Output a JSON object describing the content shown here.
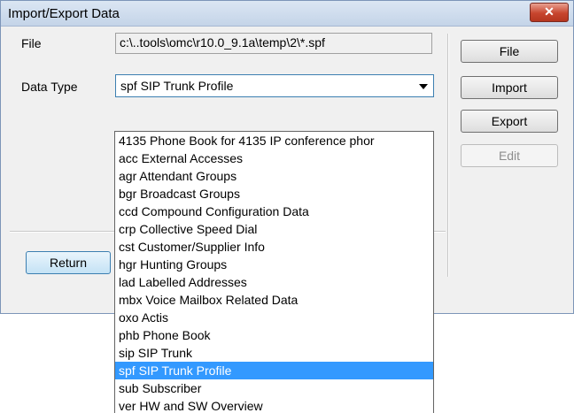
{
  "window": {
    "title": "Import/Export Data",
    "close_glyph": "✕"
  },
  "form": {
    "file_label": "File",
    "file_value": "c:\\..tools\\omc\\r10.0_9.1a\\temp\\2\\*.spf",
    "data_type_label": "Data Type",
    "data_type_selected": "spf  SIP Trunk Profile"
  },
  "buttons": {
    "file": "File",
    "import": "Import",
    "export": "Export",
    "edit": "Edit",
    "return": "Return"
  },
  "dropdown": {
    "selected_index": 14,
    "options": [
      "4135  Phone Book for 4135 IP conference phor",
      "acc  External Accesses",
      "agr  Attendant Groups",
      "bgr  Broadcast Groups",
      "ccd  Compound Configuration Data",
      "crp  Collective Speed Dial",
      "cst  Customer/Supplier Info",
      "hgr  Hunting Groups",
      "lad  Labelled Addresses",
      "mbx  Voice Mailbox Related Data",
      "oxo  Actis",
      "phb  Phone Book",
      "sip  SIP Trunk",
      "spf  SIP Trunk Profile",
      "sub  Subscriber",
      "ver  HW and SW Overview"
    ]
  },
  "colors": {
    "selection": "#3399ff",
    "focus_border": "#3c7fb1",
    "close_button": "#c7452e"
  }
}
